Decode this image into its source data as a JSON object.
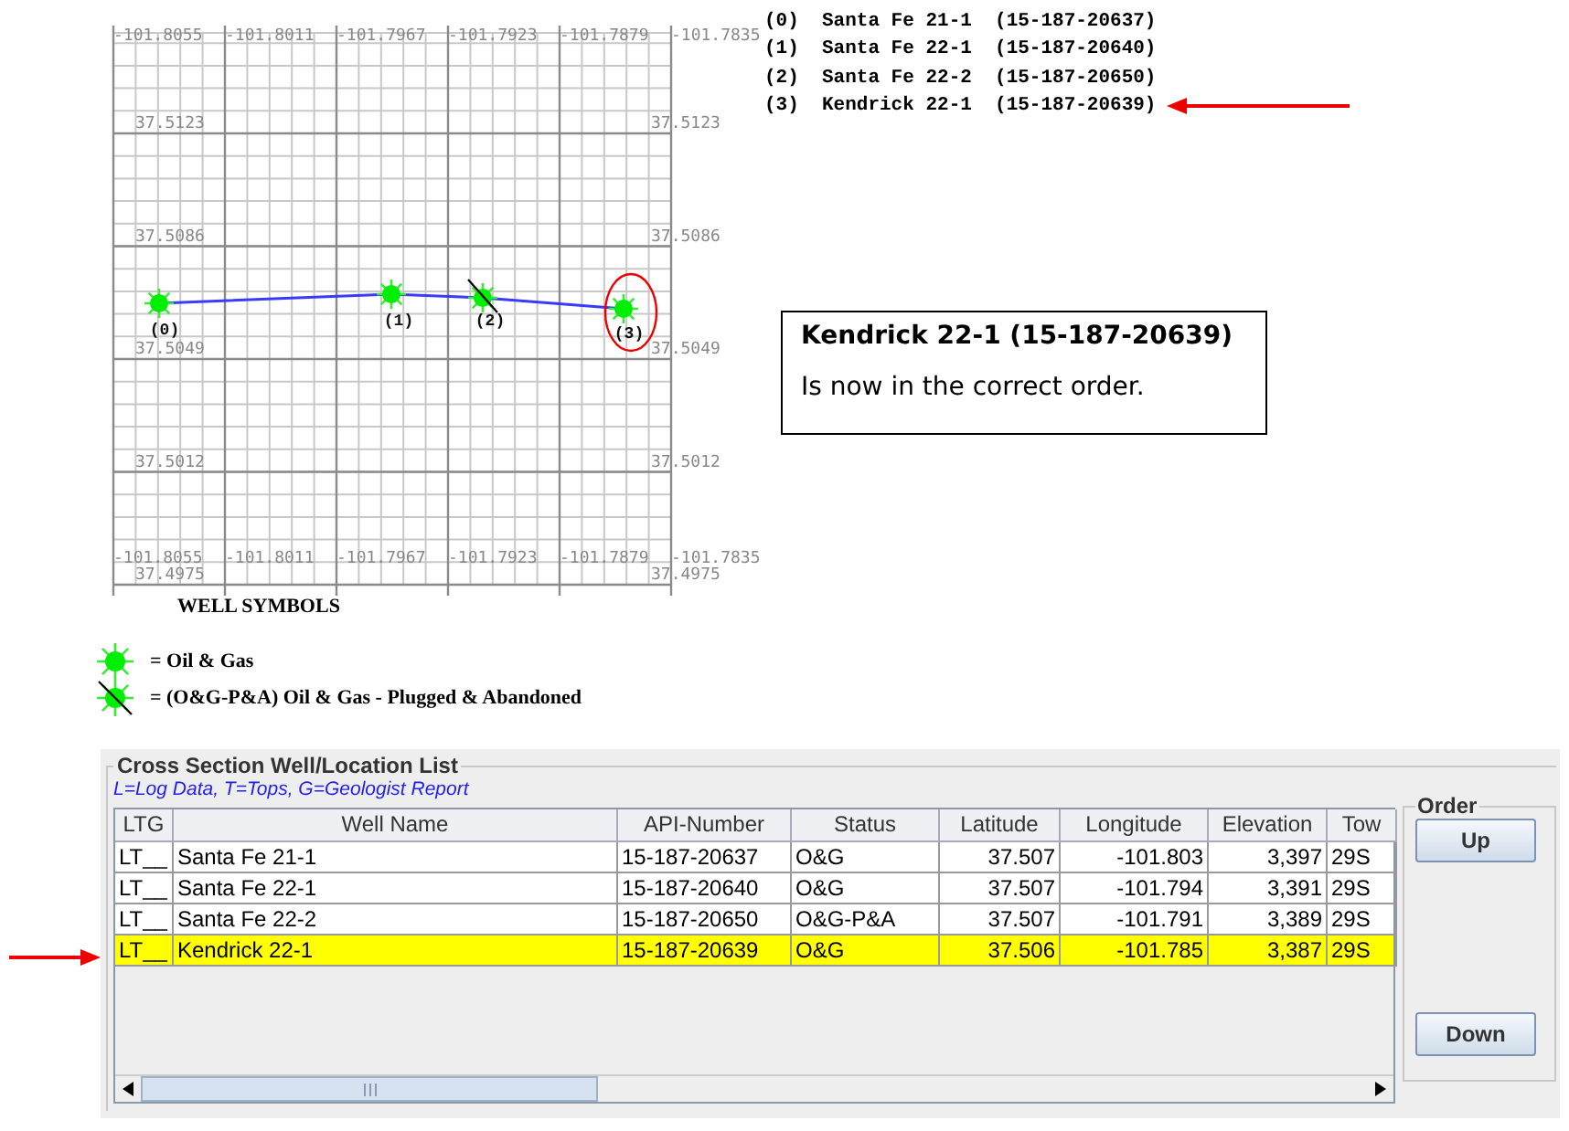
{
  "map": {
    "top_longitude_labels": [
      "-101.8055",
      "-101.8011",
      "-101.7967",
      "-101.7923",
      "-101.7879",
      "-101.7835"
    ],
    "bottom_longitude_labels": [
      "-101.8055",
      "-101.8011",
      "-101.7967",
      "-101.7923",
      "-101.7879",
      "-101.7835"
    ],
    "left_latitude_labels": [
      "37.5123",
      "37.5086",
      "37.5049",
      "37.5012",
      "37.4975"
    ],
    "right_latitude_labels": [
      "37.5123",
      "37.5086",
      "37.5049",
      "37.5012",
      "37.4975"
    ],
    "wells": [
      {
        "label": "(0)",
        "kind": "oil_gas"
      },
      {
        "label": "(1)",
        "kind": "oil_gas"
      },
      {
        "label": "(2)",
        "kind": "plugged"
      },
      {
        "label": "(3)",
        "kind": "oil_gas"
      }
    ]
  },
  "legend": {
    "title": "WELL SYMBOLS",
    "items": [
      {
        "kind": "oil_gas",
        "text": "= Oil & Gas"
      },
      {
        "kind": "plugged",
        "text": "= (O&G-P&A) Oil & Gas - Plugged & Abandoned"
      }
    ]
  },
  "well_list": [
    {
      "index": "(0)",
      "name": "Santa Fe 21-1",
      "api": "(15-187-20637)"
    },
    {
      "index": "(1)",
      "name": "Santa Fe 22-1",
      "api": "(15-187-20640)"
    },
    {
      "index": "(2)",
      "name": "Santa Fe 22-2",
      "api": "(15-187-20650)"
    },
    {
      "index": "(3)",
      "name": "Kendrick 22-1",
      "api": "(15-187-20639)"
    }
  ],
  "callout": {
    "title": "Kendrick 22-1 (15-187-20639)",
    "text": "Is now in the correct order."
  },
  "well_table": {
    "title": "Cross Section Well/Location List",
    "note": "L=Log Data, T=Tops, G=Geologist Report",
    "columns": [
      "LTG",
      "Well Name",
      "API-Number",
      "Status",
      "Latitude",
      "Longitude",
      "Elevation",
      "Tow"
    ],
    "rows": [
      {
        "cells": [
          "LT__",
          "Santa Fe 21-1",
          "15-187-20637",
          "O&G",
          "37.507",
          "-101.803",
          "3,397",
          "29S"
        ],
        "selected": false
      },
      {
        "cells": [
          "LT__",
          "Santa Fe 22-1",
          "15-187-20640",
          "O&G",
          "37.507",
          "-101.794",
          "3,391",
          "29S"
        ],
        "selected": false
      },
      {
        "cells": [
          "LT__",
          "Santa Fe 22-2",
          "15-187-20650",
          "O&G-P&A",
          "37.507",
          "-101.791",
          "3,389",
          "29S"
        ],
        "selected": false
      },
      {
        "cells": [
          "LT__",
          "Kendrick 22-1",
          "15-187-20639",
          "O&G",
          "37.506",
          "-101.785",
          "3,387",
          "29S"
        ],
        "selected": true
      }
    ]
  },
  "order": {
    "title": "Order",
    "buttons": [
      "Up",
      "Down"
    ]
  }
}
